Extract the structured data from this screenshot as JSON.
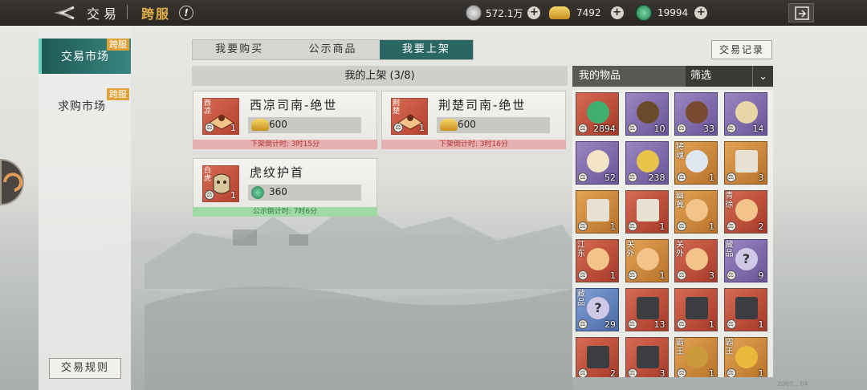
{
  "header": {
    "title": "交易",
    "subtitle": "跨服",
    "info_label": "!",
    "currencies": [
      {
        "icon": "silver-coin-icon",
        "value": "572.1万"
      },
      {
        "icon": "gold-ingot-icon",
        "value": "7492"
      },
      {
        "icon": "jade-icon",
        "value": "19994"
      }
    ]
  },
  "sidebar": {
    "items": [
      {
        "label": "交易市场",
        "tag": "跨服"
      },
      {
        "label": "求购市场",
        "tag": "跨服"
      }
    ],
    "rules_button": "交易规则"
  },
  "tabs": [
    "我要购买",
    "公示商品",
    "我要上架"
  ],
  "record_button": "交易记录",
  "listings": {
    "header": "我的上架 (3/8)",
    "cards": [
      {
        "name": "西凉司南-绝世",
        "corner": "西凉",
        "qty": "1",
        "currency_icon": "gold-ingot-icon",
        "price": "600",
        "timer": "下架倒计时: 3时15分",
        "timer_kind": "red"
      },
      {
        "name": "荆楚司南-绝世",
        "corner": "荆楚",
        "qty": "1",
        "currency_icon": "gold-ingot-icon",
        "price": "600",
        "timer": "下架倒计时: 3时16分",
        "timer_kind": "red"
      },
      {
        "name": "虎纹护首",
        "corner": "白虎",
        "qty": "1",
        "currency_icon": "jade-icon",
        "price": "360",
        "timer": "公示倒计时: 7时6分",
        "timer_kind": "green"
      }
    ]
  },
  "inventory": {
    "header": "我的物品",
    "filter": "筛选",
    "items": [
      {
        "qty": "2894",
        "quality": "red",
        "tag": "",
        "icon": "jade-dragon-icon"
      },
      {
        "qty": "10",
        "quality": "purple",
        "tag": "",
        "icon": "boots-icon"
      },
      {
        "qty": "33",
        "quality": "purple",
        "tag": "",
        "icon": "armor-figure-icon"
      },
      {
        "qty": "14",
        "quality": "purple",
        "tag": "",
        "icon": "coin-stack-icon"
      },
      {
        "qty": "52",
        "quality": "purple",
        "tag": "",
        "icon": "bun-icon"
      },
      {
        "qty": "238",
        "quality": "purple",
        "tag": "",
        "icon": "gold-pile-icon"
      },
      {
        "qty": "1",
        "quality": "orange",
        "tag": "将魂",
        "icon": "spirit-icon"
      },
      {
        "qty": "3",
        "quality": "orange",
        "tag": "",
        "icon": "scroll-icon"
      },
      {
        "qty": "1",
        "quality": "orange",
        "tag": "",
        "icon": "scroll-icon"
      },
      {
        "qty": "1",
        "quality": "red",
        "tag": "",
        "icon": "scroll-icon"
      },
      {
        "qty": "1",
        "quality": "orange",
        "tag": "幽冀",
        "icon": "compass-icon"
      },
      {
        "qty": "2",
        "quality": "red",
        "tag": "青徐",
        "icon": "compass-icon"
      },
      {
        "qty": "1",
        "quality": "red",
        "tag": "江东",
        "icon": "compass-icon"
      },
      {
        "qty": "1",
        "quality": "orange",
        "tag": "关外",
        "icon": "compass-icon"
      },
      {
        "qty": "3",
        "quality": "red",
        "tag": "关外",
        "icon": "compass-icon"
      },
      {
        "qty": "9",
        "quality": "purple",
        "tag": "藏品",
        "icon": "mystery-icon"
      },
      {
        "qty": "29",
        "quality": "blue",
        "tag": "藏品",
        "icon": "mystery-icon"
      },
      {
        "qty": "13",
        "quality": "red",
        "tag": "",
        "icon": "book-icon"
      },
      {
        "qty": "1",
        "quality": "red",
        "tag": "",
        "icon": "book-icon"
      },
      {
        "qty": "1",
        "quality": "red",
        "tag": "",
        "icon": "book-icon"
      },
      {
        "qty": "2",
        "quality": "red",
        "tag": "",
        "icon": "book-icon"
      },
      {
        "qty": "3",
        "quality": "red",
        "tag": "",
        "icon": "book-icon"
      },
      {
        "qty": "1",
        "quality": "orange",
        "tag": "霸王",
        "icon": "warrior-icon"
      },
      {
        "qty": "1",
        "quality": "orange",
        "tag": "霸王",
        "icon": "gold-ring-icon"
      }
    ]
  },
  "watermark": "2067…04",
  "colors": {
    "accent": "#2a6763",
    "tag": "#e0a33a",
    "gold": "#e3b048"
  }
}
